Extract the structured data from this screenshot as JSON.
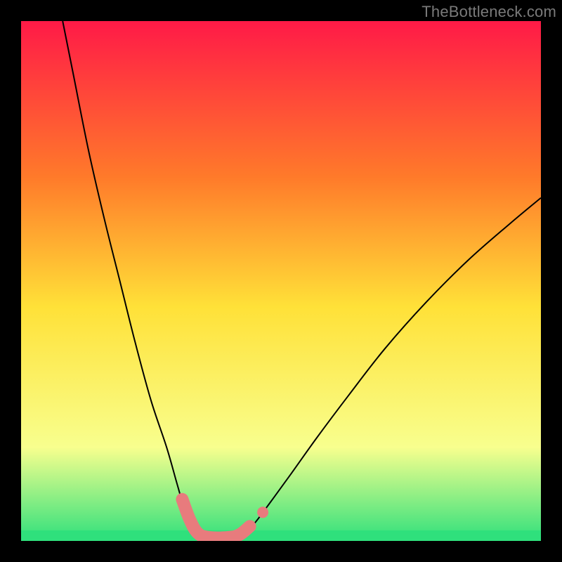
{
  "watermark": "TheBottleneck.com",
  "chart_data": {
    "type": "line",
    "title": "",
    "xlabel": "",
    "ylabel": "",
    "xlim": [
      0,
      100
    ],
    "ylim": [
      0,
      100
    ],
    "background_gradient": {
      "top": "#ff1a47",
      "mid_upper": "#ff7a2a",
      "mid": "#ffe138",
      "lower": "#f8ff8e",
      "bottom": "#2fe07c"
    },
    "series": [
      {
        "name": "bottleneck-curve",
        "style": "black-thin",
        "points": [
          {
            "x": 8.0,
            "y": 100.0
          },
          {
            "x": 10.0,
            "y": 90.0
          },
          {
            "x": 13.0,
            "y": 75.0
          },
          {
            "x": 16.0,
            "y": 62.0
          },
          {
            "x": 19.0,
            "y": 50.0
          },
          {
            "x": 22.0,
            "y": 38.0
          },
          {
            "x": 25.0,
            "y": 27.0
          },
          {
            "x": 28.0,
            "y": 18.0
          },
          {
            "x": 30.0,
            "y": 11.0
          },
          {
            "x": 31.5,
            "y": 6.0
          },
          {
            "x": 33.0,
            "y": 3.0
          },
          {
            "x": 35.0,
            "y": 1.0
          },
          {
            "x": 37.0,
            "y": 0.5
          },
          {
            "x": 41.0,
            "y": 0.5
          },
          {
            "x": 43.0,
            "y": 1.5
          },
          {
            "x": 45.0,
            "y": 3.5
          },
          {
            "x": 48.0,
            "y": 7.5
          },
          {
            "x": 52.0,
            "y": 13.0
          },
          {
            "x": 57.0,
            "y": 20.0
          },
          {
            "x": 63.0,
            "y": 28.0
          },
          {
            "x": 70.0,
            "y": 37.0
          },
          {
            "x": 78.0,
            "y": 46.0
          },
          {
            "x": 86.0,
            "y": 54.0
          },
          {
            "x": 94.0,
            "y": 61.0
          },
          {
            "x": 100.0,
            "y": 66.0
          }
        ]
      },
      {
        "name": "highlighted-range",
        "style": "pink-thick",
        "points": [
          {
            "x": 31.0,
            "y": 8.0
          },
          {
            "x": 32.5,
            "y": 4.0
          },
          {
            "x": 34.0,
            "y": 1.5
          },
          {
            "x": 36.0,
            "y": 0.7
          },
          {
            "x": 40.0,
            "y": 0.7
          },
          {
            "x": 42.0,
            "y": 1.2
          },
          {
            "x": 44.0,
            "y": 2.8
          }
        ]
      },
      {
        "name": "highlight-endpoint",
        "style": "pink-dot",
        "points": [
          {
            "x": 46.5,
            "y": 5.5
          }
        ]
      }
    ]
  }
}
